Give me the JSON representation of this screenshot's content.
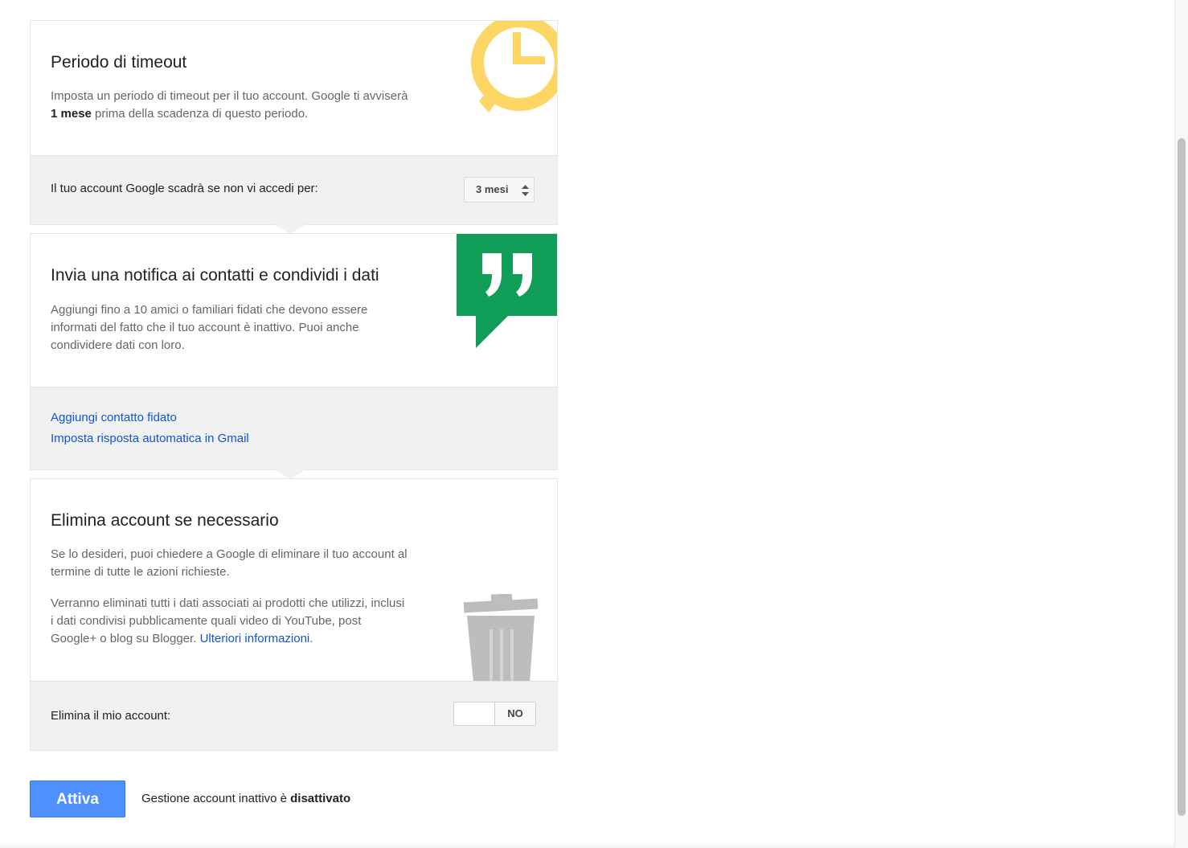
{
  "timeout": {
    "title": "Periodo di timeout",
    "desc_part1": "Imposta un periodo di timeout per il tuo account. Google ti avviserà ",
    "desc_bold": "1 mese",
    "desc_part2": " prima della scadenza di questo periodo.",
    "setting_label": "Il tuo account Google scadrà se non vi accedi per:",
    "select_value": "3 mesi",
    "icon": "alarm-clock-icon",
    "icon_color": "#fdd663"
  },
  "notify": {
    "title": "Invia una notifica ai contatti e condividi i dati",
    "desc": "Aggiungi fino a 10 amici o familiari fidati che devono essere informati del fatto che il tuo account è inattivo. Puoi anche condividere dati con loro.",
    "link_add_contact": "Aggiungi contatto fidato",
    "link_autoreply": "Imposta risposta automatica in Gmail",
    "icon": "quote-bubble-icon",
    "icon_color": "#0f9d58"
  },
  "delete": {
    "title": "Elimina account se necessario",
    "desc1": "Se lo desideri, puoi chiedere a Google di eliminare il tuo account al termine di tutte le azioni richieste.",
    "desc2": "Verranno eliminati tutti i dati associati ai prodotti che utilizzi, inclusi i dati condivisi pubblicamente quali video di YouTube, post Google+ o blog su Blogger.",
    "learn_more": "Ulteriori informazioni",
    "period": ".",
    "setting_label": "Elimina il mio account:",
    "toggle_state": "NO",
    "icon": "trash-can-icon",
    "icon_color": "#bdbdbd"
  },
  "footer": {
    "button_label": "Attiva",
    "status_prefix": "Gestione account inattivo è ",
    "status_value": "disattivato",
    "button_color": "#4d90fe"
  }
}
